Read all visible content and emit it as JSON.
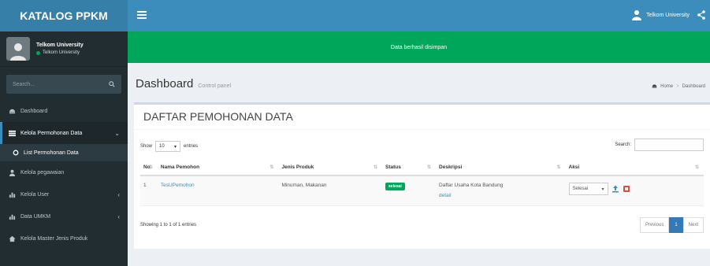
{
  "app": {
    "logo": "KATALOG PPKM"
  },
  "header": {
    "user_name": "Telkom University"
  },
  "alert": {
    "message": "Data berhasil disimpan"
  },
  "sidebar": {
    "user_name": "Telkom University",
    "user_status": "Telkom University",
    "search_placeholder": "Search...",
    "items": [
      {
        "label": "Dashboard",
        "icon": "dashboard-icon"
      },
      {
        "label": "Kelola Permohonan Data",
        "icon": "list-icon"
      },
      {
        "label": "Kelola pegawaian",
        "icon": "users-icon"
      },
      {
        "label": "Kelola User",
        "icon": "chart-icon"
      },
      {
        "label": "Data UMKM",
        "icon": "chart-icon"
      },
      {
        "label": "Kelola Master Jenis Produk",
        "icon": "home-icon"
      }
    ],
    "sub_item": "List Permohonan Data"
  },
  "page": {
    "title": "Dashboard",
    "subtitle": "Control panel",
    "breadcrumb": [
      "Home",
      "Dashboard"
    ]
  },
  "box": {
    "title": "DAFTAR PEMOHONAN DATA",
    "show_label": "Show",
    "entries_value": "10",
    "entries_label": "entries",
    "search_label": "Search:",
    "columns": [
      "No",
      "Nama Pemohon",
      "Jenis Produk",
      "Status",
      "Deskripsi",
      "Aksi"
    ],
    "rows": [
      {
        "no": "1",
        "nama": "TesUPemohon",
        "jenis": "Minuman, Makanan",
        "status": "selesai",
        "deskripsi": "Daftar Usaha Kota Bandung",
        "detail": "detail",
        "aksi": "Selesai"
      }
    ],
    "showing": "Showing 1 to 1 of 1 entries",
    "pagination": {
      "prev": "Previous",
      "page": "1",
      "next": "Next"
    }
  },
  "colors": {
    "primary": "#3c8dbc",
    "success": "#00a65a",
    "sidebar": "#222d32"
  }
}
